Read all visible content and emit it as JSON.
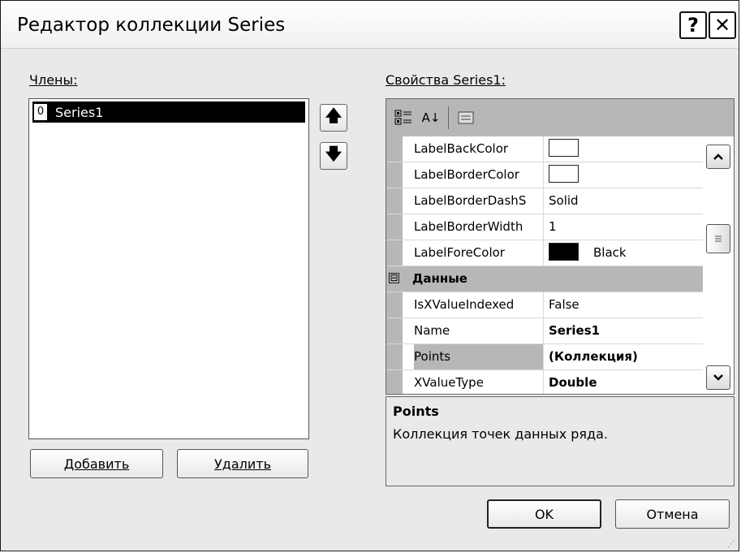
{
  "window": {
    "title": "Редактор коллекции Series",
    "help_glyph": "?",
    "close_glyph": "✕"
  },
  "members": {
    "label": "Члены:",
    "items": [
      {
        "index": "0",
        "name": "Series1"
      }
    ],
    "move_up_glyph": "🡅",
    "move_down_glyph": "🡇"
  },
  "buttons": {
    "add": "Добавить",
    "remove": "Удалить",
    "ok": "OK",
    "cancel": "Отмена"
  },
  "properties": {
    "label": "Свойства Series1:",
    "toolbar_icons": [
      "categorized-icon",
      "alphabetical-sort-icon",
      "property-pages-icon"
    ],
    "alpha_glyph": "A↓",
    "rows": [
      {
        "name": "LabelBackColor",
        "value": "",
        "swatch": "white"
      },
      {
        "name": "LabelBorderColor",
        "value": "",
        "swatch": "white"
      },
      {
        "name": "LabelBorderDashS",
        "value": "Solid"
      },
      {
        "name": "LabelBorderWidth",
        "value": "1"
      },
      {
        "name": "LabelForeColor",
        "value": "Black",
        "swatch": "black"
      }
    ],
    "category": {
      "expander": "⊟",
      "label": "Данные"
    },
    "rows2": [
      {
        "name": "IsXValueIndexed",
        "value": "False"
      },
      {
        "name": "Name",
        "value": "Series1"
      },
      {
        "name": "Points",
        "value": "(Коллекция)"
      },
      {
        "name": "XValueType",
        "value": "Double"
      }
    ],
    "description": {
      "title": "Points",
      "text": "Коллекция точек данных ряда."
    }
  }
}
